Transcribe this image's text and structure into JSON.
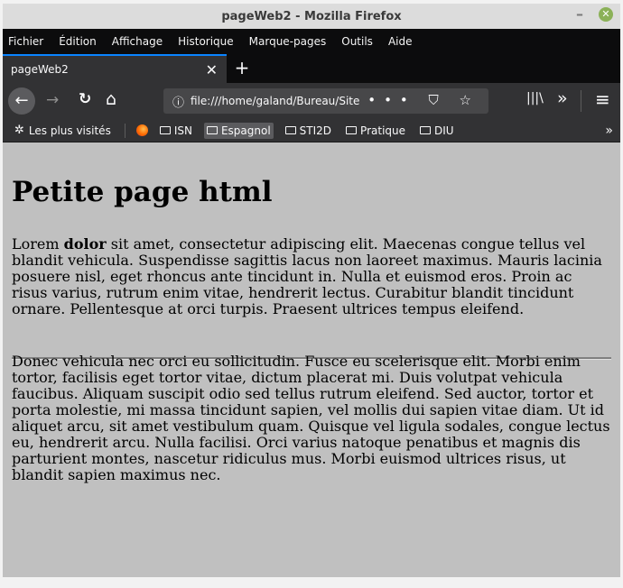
{
  "window": {
    "title": "pageWeb2 - Mozilla Firefox",
    "minimize_glyph": "–",
    "close_glyph": "✕"
  },
  "menu": [
    "Fichier",
    "Édition",
    "Affichage",
    "Historique",
    "Marque-pages",
    "Outils",
    "Aide"
  ],
  "tab": {
    "title": "pageWeb2",
    "close_glyph": "✕",
    "new_tab_glyph": "+"
  },
  "nav": {
    "back": "←",
    "forward": "→",
    "reload": "↻",
    "home": "⌂",
    "info": "ⓘ",
    "url": "file:///home/galand/Bureau/Site S",
    "page_actions": "••• ⛉ ☆",
    "library": "|||\\",
    "overflow": "»",
    "menu": "≡"
  },
  "bookmarks": {
    "most_visited": "Les plus visités",
    "folders": [
      "ISN",
      "Espagnol",
      "STI2D",
      "Pratique",
      "DIU"
    ],
    "active_folder": "Espagnol",
    "more": "»"
  },
  "page": {
    "heading": "Petite page html",
    "p1_start": "Lorem ",
    "p1_bold": "dolor",
    "p1_rest": " sit amet, consectetur adipiscing elit. Maecenas congue tellus vel blandit vehicula. Suspendisse sagittis lacus non laoreet maximus. Mauris lacinia posuere nisl, eget rhoncus ante tincidunt in. Nulla et euismod eros. Proin ac risus varius, rutrum enim vitae, hendrerit lectus. Curabitur blandit tincidunt ornare. Pellentesque at orci turpis. Praesent ultrices tempus eleifend.",
    "p2": "Donec vehicula nec orci eu sollicitudin. Fusce eu scelerisque elit. Morbi enim tortor, facilisis eget tortor vitae, dictum placerat mi. Duis volutpat vehicula faucibus. Aliquam suscipit odio sed tellus rutrum eleifend. Sed auctor, tortor et porta molestie, mi massa tincidunt sapien, vel mollis dui sapien vitae diam. Ut id aliquet arcu, sit amet vestibulum quam. Quisque vel ligula sodales, congue lectus eu, hendrerit arcu. Nulla facilisi. Orci varius natoque penatibus et magnis dis parturient montes, nascetur ridiculus mus. Morbi euismod ultrices risus, ut blandit sapien maximus nec."
  },
  "colors": {
    "page_bg": "#c0c0c0",
    "chrome_dark": "#323234",
    "accent": "#0a84ff"
  }
}
